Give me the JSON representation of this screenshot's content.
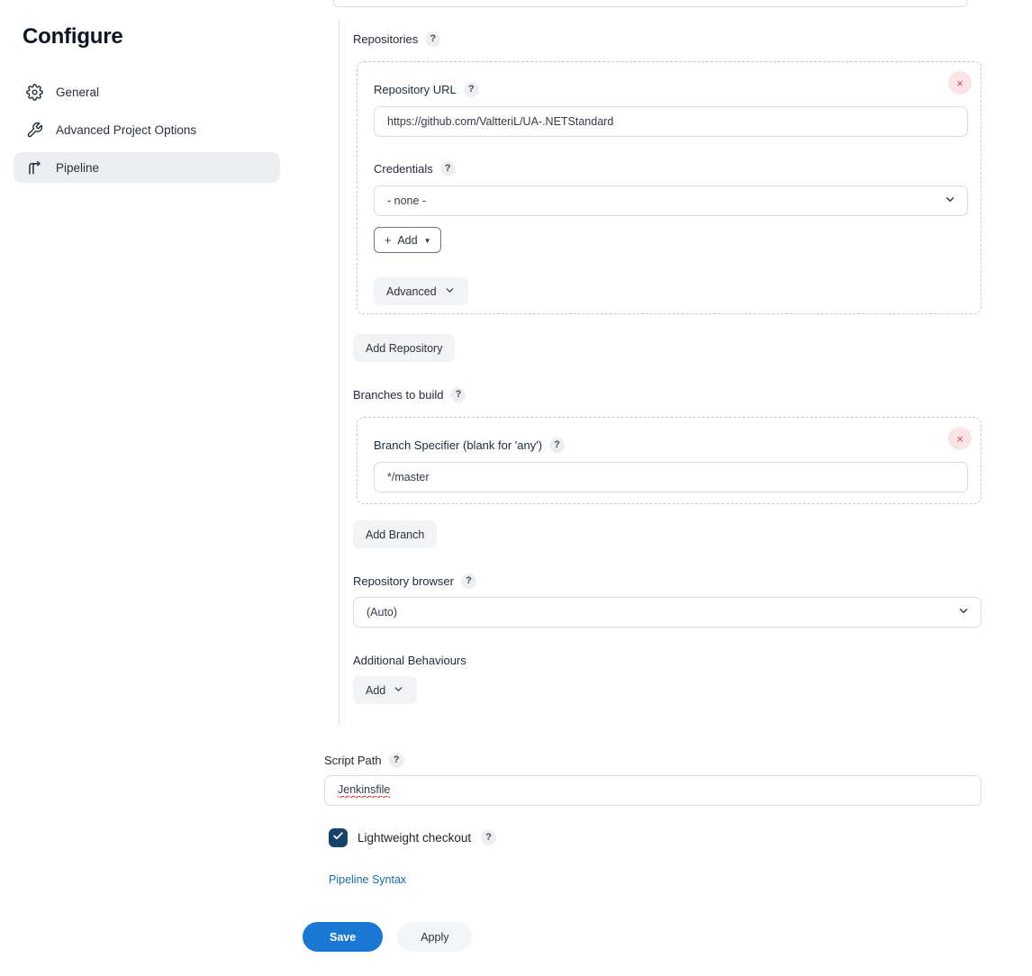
{
  "sidebar": {
    "title": "Configure",
    "items": [
      {
        "label": "General",
        "icon": "gear-icon",
        "active": false
      },
      {
        "label": "Advanced Project Options",
        "icon": "wrench-icon",
        "active": false
      },
      {
        "label": "Pipeline",
        "icon": "pipeline-icon",
        "active": true
      }
    ]
  },
  "scm": {
    "repositories": {
      "label": "Repositories",
      "help": "?",
      "entry": {
        "delete_label": "×",
        "repository_url": {
          "label": "Repository URL",
          "help": "?",
          "value": "https://github.com/ValtteriL/UA-.NETStandard"
        },
        "credentials": {
          "label": "Credentials",
          "help": "?",
          "value": "- none -",
          "options": [
            "- none -"
          ]
        },
        "add_credentials_label": "Add",
        "add_credentials_prefix": "+",
        "advanced_label": "Advanced"
      },
      "add_repository_label": "Add Repository"
    },
    "branches": {
      "label": "Branches to build",
      "help": "?",
      "entry": {
        "delete_label": "×",
        "branch_specifier": {
          "label": "Branch Specifier (blank for 'any')",
          "help": "?",
          "value": "*/master"
        }
      },
      "add_branch_label": "Add Branch"
    },
    "repository_browser": {
      "label": "Repository browser",
      "help": "?",
      "value": "(Auto)",
      "options": [
        "(Auto)"
      ]
    },
    "additional_behaviours": {
      "label": "Additional Behaviours",
      "add_label": "Add"
    }
  },
  "script_path": {
    "label": "Script Path",
    "help": "?",
    "value": "Jenkinsfile"
  },
  "lightweight_checkout": {
    "label": "Lightweight checkout",
    "help": "?",
    "checked": true
  },
  "pipeline_syntax_link": "Pipeline Syntax",
  "footer": {
    "save_label": "Save",
    "apply_label": "Apply"
  },
  "colors": {
    "accent_blue": "#1878d4",
    "link_blue": "#1b6ca8",
    "checkbox_navy": "#17436b",
    "delete_red": "#d8455b",
    "delete_bg": "#fbe3e6",
    "sidebar_active_bg": "#eceef2",
    "grey_button_bg": "#f2f3f5",
    "dashed_border": "#c4c9d0",
    "input_border": "#d7dbe0"
  }
}
